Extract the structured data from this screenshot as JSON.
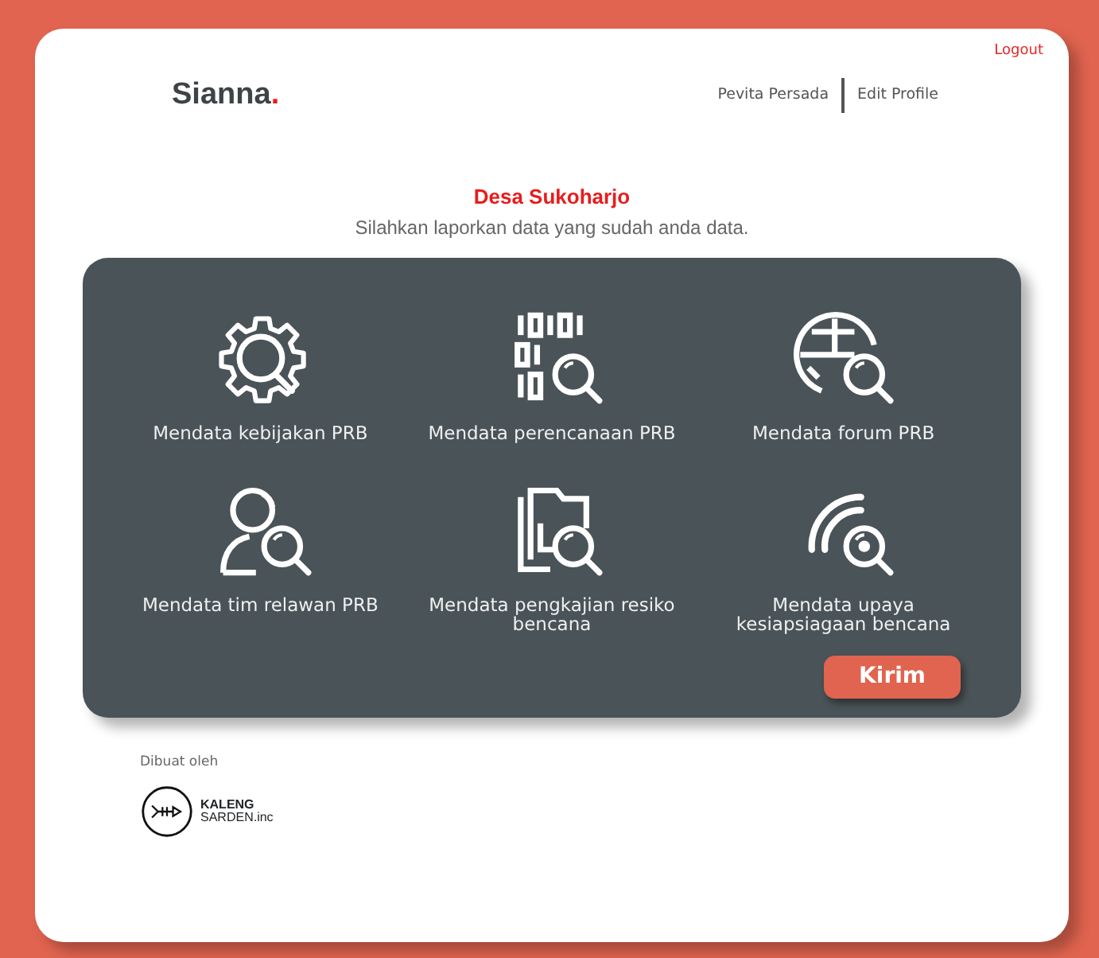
{
  "header": {
    "logout": "Logout",
    "logo": {
      "name": "Sianna",
      "mark": "."
    },
    "user": "Pevita Persada",
    "edit_profile": "Edit Profile"
  },
  "intro": {
    "title": "Desa Sukoharjo",
    "subtitle": "Silahkan laporkan data yang sudah anda data."
  },
  "items": [
    {
      "kind": "gear",
      "label": "Mendata kebijakan PRB"
    },
    {
      "kind": "code",
      "label": "Mendata perencanaan PRB"
    },
    {
      "kind": "globe",
      "label": "Mendata forum PRB"
    },
    {
      "kind": "person",
      "label": "Mendata tim relawan PRB"
    },
    {
      "kind": "folder",
      "label": "Mendata pengkajian resiko bencana"
    },
    {
      "kind": "signal",
      "label": "Mendata upaya kesiapsiagaan bencana"
    }
  ],
  "submit": "Kirim",
  "footer": {
    "credit": "Dibuat oleh",
    "brand_top": "KALENG",
    "brand_bottom": "SARDEN.inc"
  }
}
